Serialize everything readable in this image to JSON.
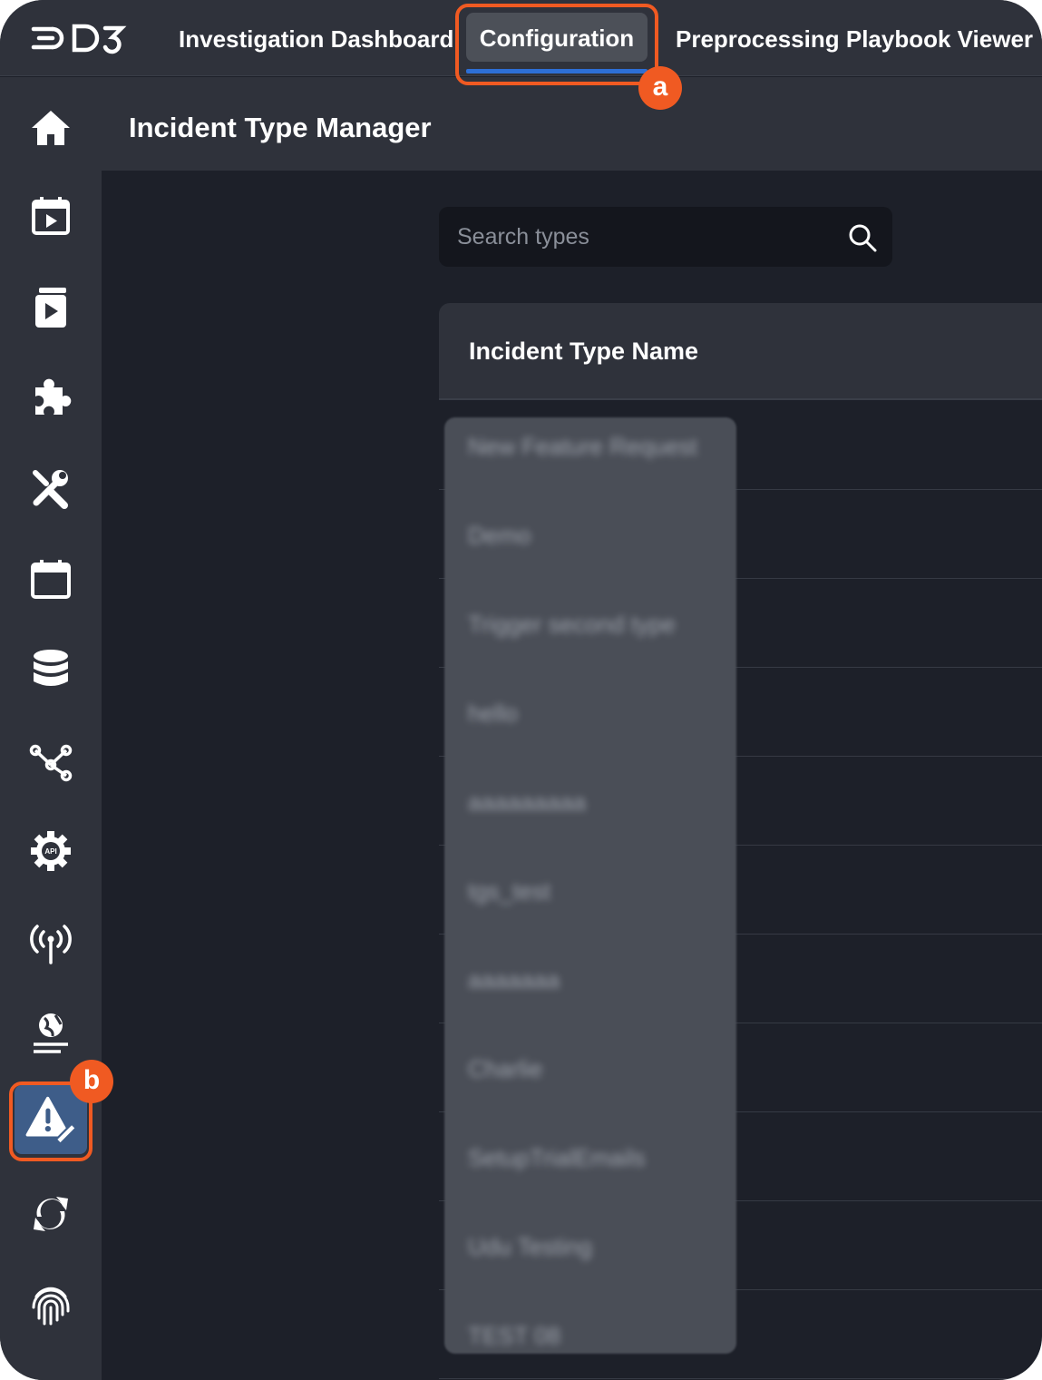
{
  "topbar": {
    "logo_text": "D3",
    "tabs": [
      {
        "label": "Investigation Dashboard"
      },
      {
        "label": "Configuration"
      },
      {
        "label": "Preprocessing Playbook Viewer"
      }
    ]
  },
  "callouts": {
    "a": "a",
    "b": "b"
  },
  "sidebar": {
    "items": [
      {
        "icon": "home-icon"
      },
      {
        "icon": "calendar-play-icon"
      },
      {
        "icon": "playbook-icon"
      },
      {
        "icon": "puzzle-icon"
      },
      {
        "icon": "tools-icon"
      },
      {
        "icon": "calendar-icon"
      },
      {
        "icon": "database-icon"
      },
      {
        "icon": "share-nodes-icon"
      },
      {
        "icon": "api-gear-icon"
      },
      {
        "icon": "broadcast-icon"
      },
      {
        "icon": "globe-icon"
      },
      {
        "icon": "incident-type-icon"
      },
      {
        "icon": "sync-icon"
      },
      {
        "icon": "fingerprint-icon"
      }
    ]
  },
  "header": {
    "title": "Incident Type Manager"
  },
  "search": {
    "placeholder": "Search types"
  },
  "table": {
    "column_header": "Incident Type Name",
    "rows": [
      "New Feature Request",
      "Demo",
      "Trigger second type",
      "hello",
      "aaaaaaaaa",
      "tgs_test",
      "aaaaaaa",
      "Charlie",
      "SetupTrialEmails",
      "Udu Testing",
      "TEST 08"
    ]
  },
  "colors": {
    "accent": "#2d6fd6",
    "callout": "#f05a22",
    "active_sidebar": "#3e5d89",
    "background": "#1d2029",
    "panel": "#2f323b"
  }
}
